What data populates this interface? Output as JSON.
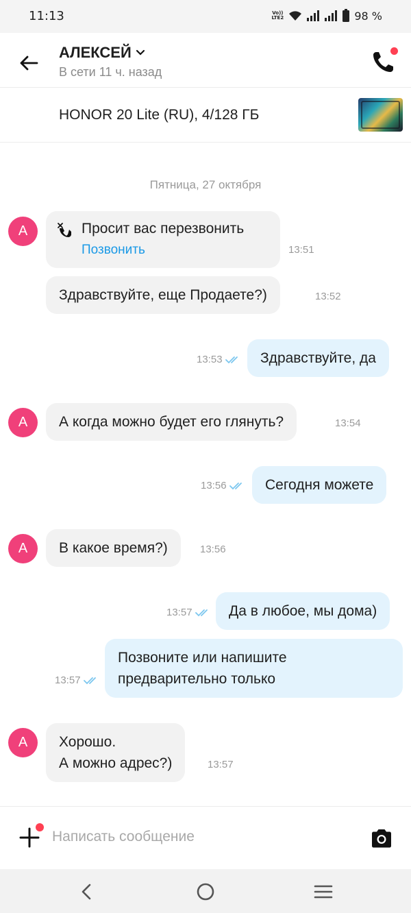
{
  "status_bar": {
    "time": "11:13",
    "volte_label_1": "Vo))",
    "volte_label_2": "LTE2",
    "battery": "98 %"
  },
  "header": {
    "name": "АЛЕКСЕЙ",
    "status": "В сети 11 ч. назад",
    "accent": "#ff4053"
  },
  "listing": {
    "title": "HONOR 20 Lite (RU), 4/128 ГБ"
  },
  "chat": {
    "date": "Пятница, 27 октября",
    "avatar_letter": "А",
    "call_request": {
      "text": "Просит вас перезвонить",
      "link": "Позвонить",
      "time": "13:51"
    },
    "messages": [
      {
        "direction": "in",
        "text": "Здравствуйте, еще Продаете?)",
        "time": "13:52"
      },
      {
        "direction": "out",
        "text": "Здравствуйте, да",
        "time": "13:53"
      },
      {
        "direction": "in",
        "text": "А когда можно будет его глянуть?",
        "time": "13:54"
      },
      {
        "direction": "out",
        "text": "Сегодня можете",
        "time": "13:56"
      },
      {
        "direction": "in",
        "text": "В какое время?)",
        "time": "13:56"
      },
      {
        "direction": "out",
        "text": "Да в любое, мы дома)",
        "time": "13:57"
      },
      {
        "direction": "out",
        "text": "Позвоните или напишите\nпредварительно только",
        "time": "13:57"
      },
      {
        "direction": "in",
        "text": "Хорошо.\nА можно адрес?)",
        "time": "13:57"
      }
    ]
  },
  "composer": {
    "placeholder": "Написать сообщение"
  },
  "colors": {
    "incoming_bubble": "#f2f2f2",
    "outgoing_bubble": "#e3f3fd",
    "link": "#1a99e6",
    "avatar": "#f0407a",
    "read_ticks": "#7cc7ef"
  }
}
